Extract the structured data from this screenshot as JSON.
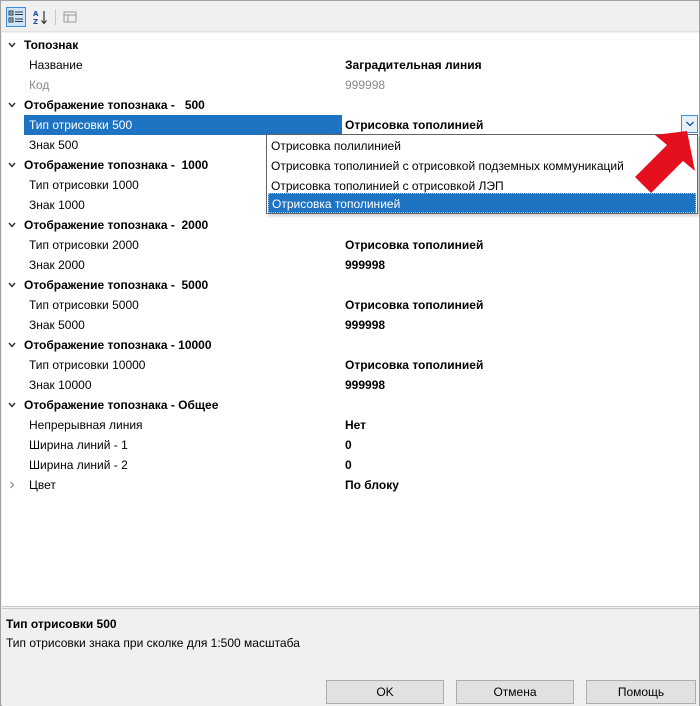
{
  "toolbar": {
    "categorized_icon": "categorized-view-icon",
    "alphabetical_icon": "alphabetical-sort-icon",
    "pages_icon": "property-pages-icon"
  },
  "grid": {
    "rows": [
      {
        "kind": "category",
        "label": "Топознак",
        "expanded": true
      },
      {
        "kind": "prop",
        "name": "Название",
        "value": "Заградительная линия"
      },
      {
        "kind": "prop",
        "name": "Код",
        "value": "999998",
        "disabled": true
      },
      {
        "kind": "category",
        "label": "Отображение топознака -   500",
        "expanded": true
      },
      {
        "kind": "prop",
        "name": "Тип отрисовки 500",
        "value": "Отрисовка тополинией",
        "selected": true
      },
      {
        "kind": "prop",
        "name": "Знак 500",
        "value": ""
      },
      {
        "kind": "category",
        "label": "Отображение топознака -  1000",
        "expanded": true
      },
      {
        "kind": "prop",
        "name": "Тип отрисовки 1000",
        "value": ""
      },
      {
        "kind": "prop",
        "name": "Знак 1000",
        "value": ""
      },
      {
        "kind": "category",
        "label": "Отображение топознака -  2000",
        "expanded": true
      },
      {
        "kind": "prop",
        "name": "Тип отрисовки 2000",
        "value": "Отрисовка тополинией"
      },
      {
        "kind": "prop",
        "name": "Знак 2000",
        "value": "999998"
      },
      {
        "kind": "category",
        "label": "Отображение топознака -  5000",
        "expanded": true
      },
      {
        "kind": "prop",
        "name": "Тип отрисовки 5000",
        "value": "Отрисовка тополинией"
      },
      {
        "kind": "prop",
        "name": "Знак 5000",
        "value": "999998"
      },
      {
        "kind": "category",
        "label": "Отображение топознака - 10000",
        "expanded": true
      },
      {
        "kind": "prop",
        "name": "Тип отрисовки 10000",
        "value": "Отрисовка тополинией"
      },
      {
        "kind": "prop",
        "name": "Знак 10000",
        "value": "999998"
      },
      {
        "kind": "category",
        "label": "Отображение топознака - Общее",
        "expanded": true
      },
      {
        "kind": "prop",
        "name": "Непрерывная линия",
        "value": "Нет"
      },
      {
        "kind": "prop",
        "name": "Ширина линий - 1",
        "value": "0"
      },
      {
        "kind": "prop",
        "name": "Ширина линий - 2",
        "value": "0"
      },
      {
        "kind": "prop",
        "name": "Цвет",
        "value": "По блоку",
        "collapsible": true
      }
    ]
  },
  "dropdown": {
    "options": [
      "Отрисовка полилинией",
      "Отрисовка тополинией с отрисовкой подземных коммуникаций",
      "Отрисовка тополинией с отрисовкой ЛЭП",
      "Отрисовка тополинией"
    ],
    "selected_index": 3
  },
  "description": {
    "title": "Тип отрисовки 500",
    "text": "Тип отрисовки знака при сколке для 1:500 масштаба"
  },
  "buttons": {
    "ok": "OK",
    "cancel": "Отмена",
    "help": "Помощь"
  },
  "colors": {
    "selection": "#1e73c2",
    "annotation_arrow": "#e5101f",
    "accent_border": "#3d8ee0"
  }
}
